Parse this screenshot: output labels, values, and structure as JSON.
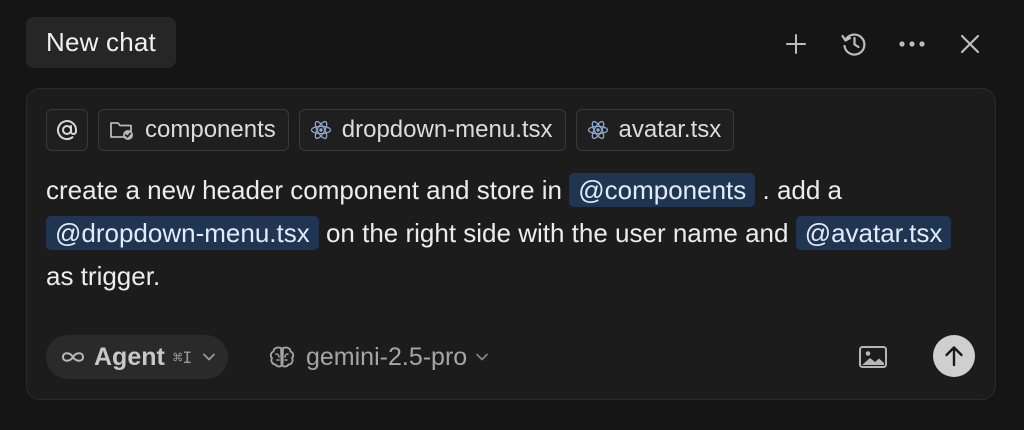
{
  "header": {
    "tab_title": "New chat",
    "actions": [
      {
        "name": "new-chat",
        "icon": "plus-icon"
      },
      {
        "name": "history",
        "icon": "history-icon"
      },
      {
        "name": "more",
        "icon": "more-icon"
      },
      {
        "name": "close",
        "icon": "close-icon"
      }
    ]
  },
  "composer": {
    "context_chips": [
      {
        "label": "@",
        "icon": "at-icon"
      },
      {
        "label": "components",
        "icon": "folder-icon"
      },
      {
        "label": "dropdown-menu.tsx",
        "icon": "react-icon"
      },
      {
        "label": "avatar.tsx",
        "icon": "react-icon"
      }
    ],
    "message": {
      "t1": "create a new header component and store in ",
      "m1": "@components",
      "t2": " .  add a ",
      "m2": "@dropdown-menu.tsx",
      "t3": " on the right side with the user name and ",
      "m3": "@avatar.tsx",
      "t4": " as trigger."
    },
    "footer": {
      "mode": {
        "label": "Agent",
        "shortcut": "⌘I",
        "icon": "infinity-icon"
      },
      "model": {
        "label": "gemini-2.5-pro",
        "icon": "brain-icon"
      },
      "image_icon": "image-icon",
      "send_icon": "arrow-up-icon"
    }
  },
  "colors": {
    "background": "#151515",
    "composer_bg": "#1c1c1c",
    "mention_bg": "#1f3552",
    "send_bg": "#cfcfcf"
  }
}
